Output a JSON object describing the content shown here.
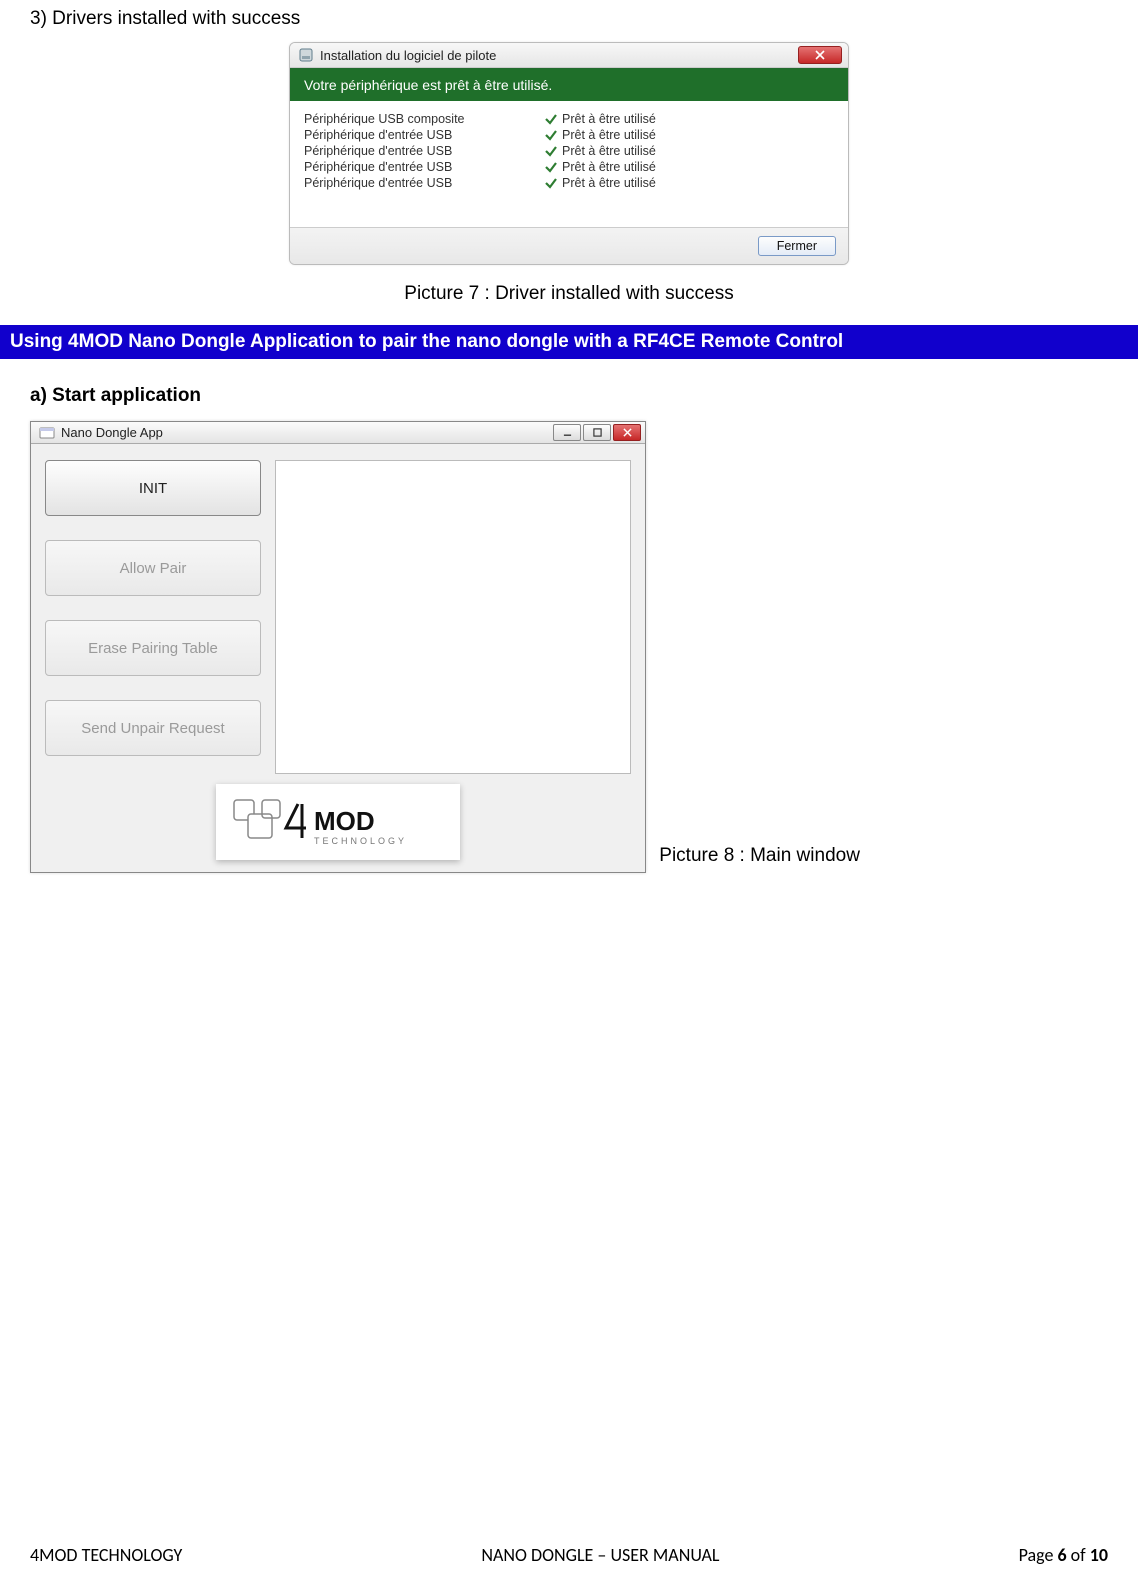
{
  "step_heading": "3) Drivers installed with success",
  "dialog1": {
    "title": "Installation du logiciel de pilote",
    "banner": "Votre périphérique est prêt à être utilisé.",
    "devices": [
      {
        "name": "Périphérique USB composite",
        "status": "Prêt à être utilisé"
      },
      {
        "name": "Périphérique d'entrée USB",
        "status": "Prêt à être utilisé"
      },
      {
        "name": "Périphérique d'entrée USB",
        "status": "Prêt à être utilisé"
      },
      {
        "name": "Périphérique d'entrée USB",
        "status": "Prêt à être utilisé"
      },
      {
        "name": "Périphérique d'entrée USB",
        "status": "Prêt à être utilisé"
      }
    ],
    "close_label": "Fermer"
  },
  "caption1": "Picture 7 : Driver installed with success",
  "section_banner": "Using  4MOD Nano Dongle Application to pair the nano dongle with a RF4CE Remote Control",
  "subhead_a": "a) Start application",
  "app": {
    "title": "Nano Dongle App",
    "buttons": {
      "init": "INIT",
      "allow": "Allow Pair",
      "erase": "Erase Pairing Table",
      "unpair": "Send Unpair Request"
    },
    "logo_text_main": "MOD",
    "logo_text_sub": "TECHNOLOGY"
  },
  "caption2": "Picture 8 : Main window",
  "footer": {
    "left": "4MOD TECHNOLOGY",
    "center": "NANO DONGLE – USER MANUAL",
    "page_prefix": "Page ",
    "page_num": "6",
    "page_of": " of ",
    "page_total": "10"
  }
}
